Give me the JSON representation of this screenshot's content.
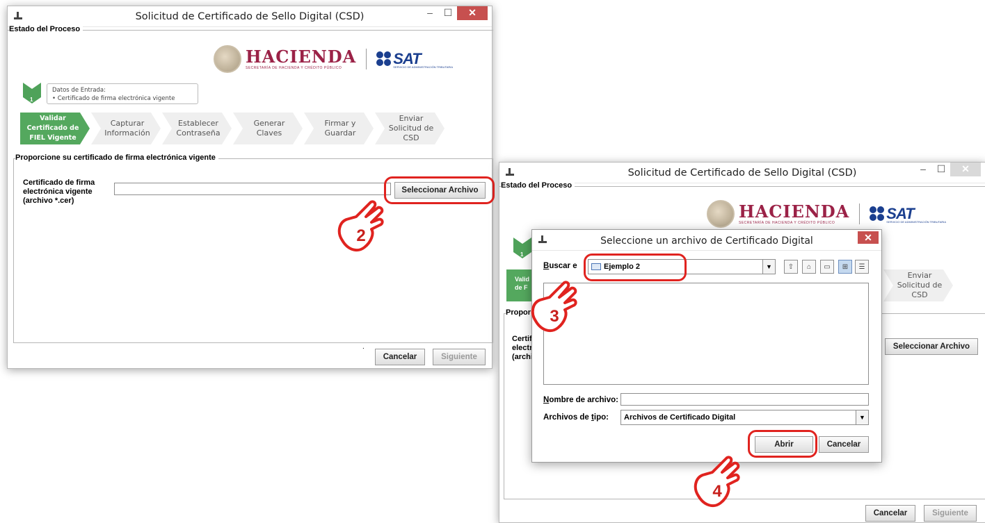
{
  "window1": {
    "title": "Solicitud de Certificado de Sello Digital (CSD)",
    "group_process": "Estado del Proceso",
    "hacienda_label": "HACIENDA",
    "hacienda_sub": "SECRETARÍA DE HACIENDA Y CRÉDITO PÚBLICO",
    "sat_label": "SAT",
    "sat_sub": "SERVICIO DE ADMINISTRACIÓN TRIBUTARIA",
    "step_number": "1",
    "info_title": "Datos de Entrada:",
    "info_item": "Certificado de firma electrónica vigente",
    "steps": [
      "Validar Certificado de FIEL Vigente",
      "Capturar Información",
      "Establecer Contraseña",
      "Generar Claves",
      "Firmar y Guardar",
      "Enviar Solicitud de CSD"
    ],
    "group_cert": "Proporcione su certificado de firma electrónica vigente",
    "cert_label": "Certificado de firma electrónica vigente (archivo *.cer)",
    "select_button": "Seleccionar Archivo",
    "cancel_button": "Cancelar",
    "next_button": "Siguiente",
    "status_dot": "."
  },
  "window2": {
    "title": "Solicitud de Certificado de Sello Digital (CSD)",
    "group_process": "Estado del Proceso",
    "hacienda_label": "HACIENDA",
    "hacienda_sub": "SECRETARÍA DE HACIENDA Y CRÉDITO PÚBLICO",
    "sat_label": "SAT",
    "sat_sub": "SERVICIO DE ADMINISTRACIÓN TRIBUTARIA",
    "step_number": "1",
    "step_partial_a": "Valid",
    "step_partial_b": "de F",
    "step_last": "Enviar Solicitud de CSD",
    "group_partial": "Propor",
    "cert_partial_1": "Certif",
    "cert_partial_2": "electr",
    "cert_partial_3": "(archi",
    "select_button": "Seleccionar Archivo",
    "cancel_button": "Cancelar",
    "next_button": "Siguiente"
  },
  "dialog": {
    "title": "Seleccione un archivo de Certificado Digital",
    "lookin_prefix": "B",
    "lookin_rest": "uscar e",
    "lookin_value": "Ejemplo 2",
    "filename_prefix": "N",
    "filename_rest": "ombre de archivo:",
    "filetype_prefix": "Archivos de ",
    "filetype_u": "t",
    "filetype_rest": "ipo:",
    "filetype_value": "Archivos de Certificado Digital",
    "open_button": "Abrir",
    "cancel_button": "Cancelar"
  },
  "annotations": {
    "hand2": "2",
    "hand3": "3",
    "hand4": "4",
    "accent_color": "#e0231f"
  },
  "icons": [
    "app-icon",
    "minimize-icon",
    "maximize-icon",
    "close-icon",
    "folder-icon",
    "up-folder-icon",
    "home-icon",
    "new-folder-icon",
    "list-view-icon",
    "details-view-icon",
    "dropdown-arrow-icon",
    "pointing-hand-icon"
  ]
}
